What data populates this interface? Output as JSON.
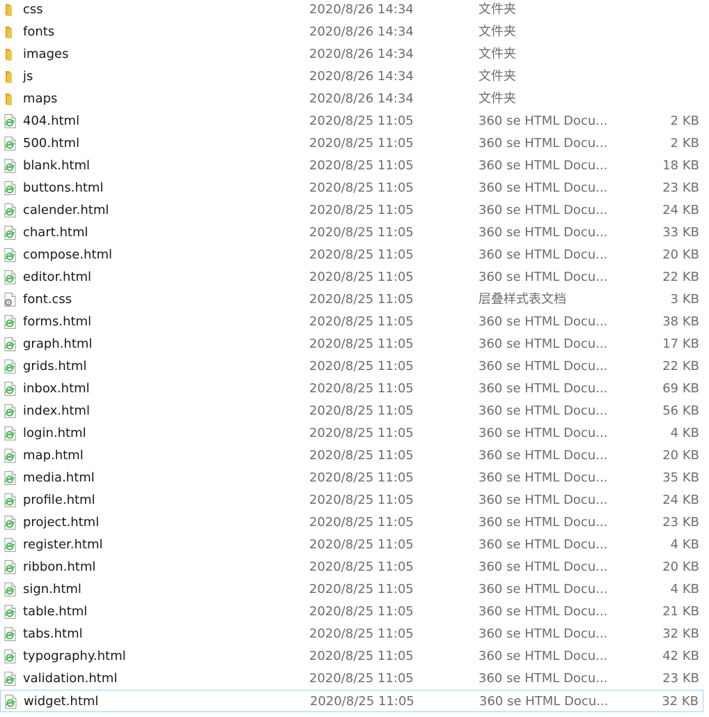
{
  "files": [
    {
      "name": "css",
      "date": "2020/8/26 14:34",
      "type": "文件夹",
      "size": "",
      "icon": "folder-icon"
    },
    {
      "name": "fonts",
      "date": "2020/8/26 14:34",
      "type": "文件夹",
      "size": "",
      "icon": "folder-icon"
    },
    {
      "name": "images",
      "date": "2020/8/26 14:34",
      "type": "文件夹",
      "size": "",
      "icon": "folder-icon"
    },
    {
      "name": "js",
      "date": "2020/8/26 14:34",
      "type": "文件夹",
      "size": "",
      "icon": "folder-icon"
    },
    {
      "name": "maps",
      "date": "2020/8/26 14:34",
      "type": "文件夹",
      "size": "",
      "icon": "folder-icon"
    },
    {
      "name": "404.html",
      "date": "2020/8/25 11:05",
      "type": "360 se HTML Docu...",
      "size": "2 KB",
      "icon": "html-file-icon"
    },
    {
      "name": "500.html",
      "date": "2020/8/25 11:05",
      "type": "360 se HTML Docu...",
      "size": "2 KB",
      "icon": "html-file-icon"
    },
    {
      "name": "blank.html",
      "date": "2020/8/25 11:05",
      "type": "360 se HTML Docu...",
      "size": "18 KB",
      "icon": "html-file-icon"
    },
    {
      "name": "buttons.html",
      "date": "2020/8/25 11:05",
      "type": "360 se HTML Docu...",
      "size": "23 KB",
      "icon": "html-file-icon"
    },
    {
      "name": "calender.html",
      "date": "2020/8/25 11:05",
      "type": "360 se HTML Docu...",
      "size": "24 KB",
      "icon": "html-file-icon"
    },
    {
      "name": "chart.html",
      "date": "2020/8/25 11:05",
      "type": "360 se HTML Docu...",
      "size": "33 KB",
      "icon": "html-file-icon"
    },
    {
      "name": "compose.html",
      "date": "2020/8/25 11:05",
      "type": "360 se HTML Docu...",
      "size": "20 KB",
      "icon": "html-file-icon"
    },
    {
      "name": "editor.html",
      "date": "2020/8/25 11:05",
      "type": "360 se HTML Docu...",
      "size": "22 KB",
      "icon": "html-file-icon"
    },
    {
      "name": "font.css",
      "date": "2020/8/25 11:05",
      "type": "层叠样式表文档",
      "size": "3 KB",
      "icon": "css-file-icon"
    },
    {
      "name": "forms.html",
      "date": "2020/8/25 11:05",
      "type": "360 se HTML Docu...",
      "size": "38 KB",
      "icon": "html-file-icon"
    },
    {
      "name": "graph.html",
      "date": "2020/8/25 11:05",
      "type": "360 se HTML Docu...",
      "size": "17 KB",
      "icon": "html-file-icon"
    },
    {
      "name": "grids.html",
      "date": "2020/8/25 11:05",
      "type": "360 se HTML Docu...",
      "size": "22 KB",
      "icon": "html-file-icon"
    },
    {
      "name": "inbox.html",
      "date": "2020/8/25 11:05",
      "type": "360 se HTML Docu...",
      "size": "69 KB",
      "icon": "html-file-icon"
    },
    {
      "name": "index.html",
      "date": "2020/8/25 11:05",
      "type": "360 se HTML Docu...",
      "size": "56 KB",
      "icon": "html-file-icon"
    },
    {
      "name": "login.html",
      "date": "2020/8/25 11:05",
      "type": "360 se HTML Docu...",
      "size": "4 KB",
      "icon": "html-file-icon"
    },
    {
      "name": "map.html",
      "date": "2020/8/25 11:05",
      "type": "360 se HTML Docu...",
      "size": "20 KB",
      "icon": "html-file-icon"
    },
    {
      "name": "media.html",
      "date": "2020/8/25 11:05",
      "type": "360 se HTML Docu...",
      "size": "35 KB",
      "icon": "html-file-icon"
    },
    {
      "name": "profile.html",
      "date": "2020/8/25 11:05",
      "type": "360 se HTML Docu...",
      "size": "24 KB",
      "icon": "html-file-icon"
    },
    {
      "name": "project.html",
      "date": "2020/8/25 11:05",
      "type": "360 se HTML Docu...",
      "size": "23 KB",
      "icon": "html-file-icon"
    },
    {
      "name": "register.html",
      "date": "2020/8/25 11:05",
      "type": "360 se HTML Docu...",
      "size": "4 KB",
      "icon": "html-file-icon"
    },
    {
      "name": "ribbon.html",
      "date": "2020/8/25 11:05",
      "type": "360 se HTML Docu...",
      "size": "20 KB",
      "icon": "html-file-icon"
    },
    {
      "name": "sign.html",
      "date": "2020/8/25 11:05",
      "type": "360 se HTML Docu...",
      "size": "4 KB",
      "icon": "html-file-icon"
    },
    {
      "name": "table.html",
      "date": "2020/8/25 11:05",
      "type": "360 se HTML Docu...",
      "size": "21 KB",
      "icon": "html-file-icon"
    },
    {
      "name": "tabs.html",
      "date": "2020/8/25 11:05",
      "type": "360 se HTML Docu...",
      "size": "32 KB",
      "icon": "html-file-icon"
    },
    {
      "name": "typography.html",
      "date": "2020/8/25 11:05",
      "type": "360 se HTML Docu...",
      "size": "42 KB",
      "icon": "html-file-icon"
    },
    {
      "name": "validation.html",
      "date": "2020/8/25 11:05",
      "type": "360 se HTML Docu...",
      "size": "23 KB",
      "icon": "html-file-icon"
    },
    {
      "name": "widget.html",
      "date": "2020/8/25 11:05",
      "type": "360 se HTML Docu...",
      "size": "32 KB",
      "icon": "html-file-icon"
    }
  ],
  "colors": {
    "folder": "#f3c33c",
    "folder_dark": "#dca52a",
    "html_icon_accent": "#3cb54a",
    "css_icon_gear": "#8a8a8a",
    "secondary_text": "#6d6d6d",
    "focus_outline": "#99d1ff"
  }
}
